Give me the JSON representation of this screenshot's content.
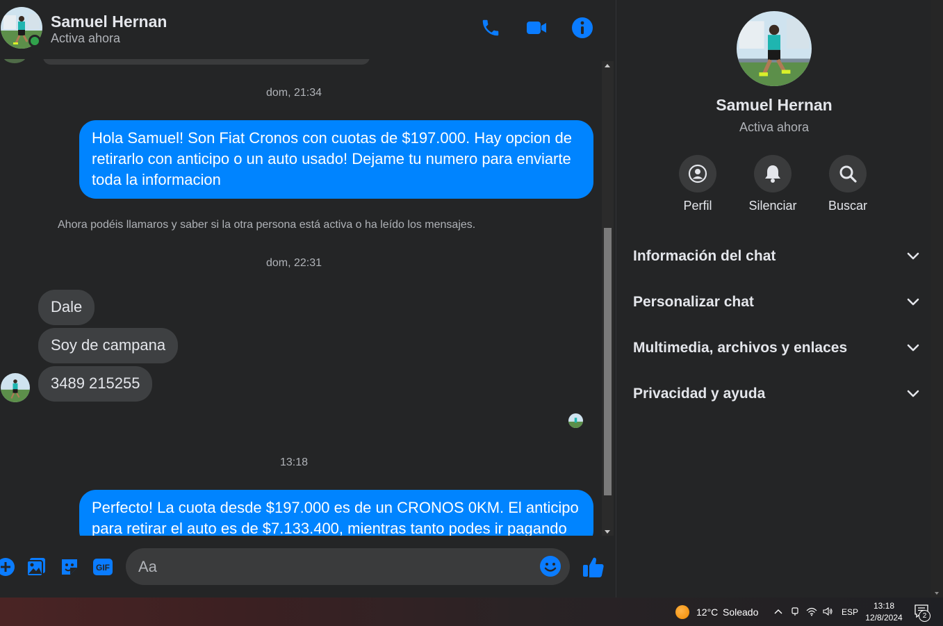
{
  "header": {
    "contact_name": "Samuel Hernan",
    "status": "Activa ahora",
    "call_icon": "phone-icon",
    "video_icon": "video-camera-icon",
    "info_icon": "info-icon"
  },
  "messages": {
    "timestamp_1": "dom, 21:34",
    "outgoing_1": "Hola Samuel! Son Fiat Cronos con cuotas de $197.000. Hay opcion de retirarlo con anticipo o un auto usado! Dejame tu numero para enviarte toda la informacion",
    "system_notice": "Ahora podéis llamaros y saber si la otra persona está activa o ha leído los mensajes.",
    "timestamp_2": "dom, 22:31",
    "incoming": [
      "Dale",
      "Soy de campana",
      "3489 215255"
    ],
    "timestamp_3": "13:18",
    "outgoing_2": "Perfecto! La cuota desde $197.000 es de un CRONOS 0KM. El anticipo para retirar el auto es de $7.133.400, mientras tanto podes ir pagando"
  },
  "composer": {
    "placeholder": "Aa",
    "icons": [
      "plus-icon",
      "image-icon",
      "sticker-icon",
      "gif-icon",
      "emoji-icon",
      "thumbs-up-icon"
    ],
    "gif_label": "GIF"
  },
  "panel": {
    "name": "Samuel Hernan",
    "status": "Activa ahora",
    "actions": [
      {
        "label": "Perfil",
        "icon": "profile-icon"
      },
      {
        "label": "Silenciar",
        "icon": "bell-icon"
      },
      {
        "label": "Buscar",
        "icon": "search-icon"
      }
    ],
    "sections": [
      "Información del chat",
      "Personalizar chat",
      "Multimedia, archivos y enlaces",
      "Privacidad y ayuda"
    ]
  },
  "taskbar": {
    "temperature": "12°C",
    "weather": "Soleado",
    "language": "ESP",
    "time": "13:18",
    "date": "12/8/2024",
    "notifications": "2"
  },
  "colors": {
    "accent": "#0084ff",
    "background": "#242526",
    "incoming_bubble": "#3e4042",
    "online": "#31a24c"
  }
}
